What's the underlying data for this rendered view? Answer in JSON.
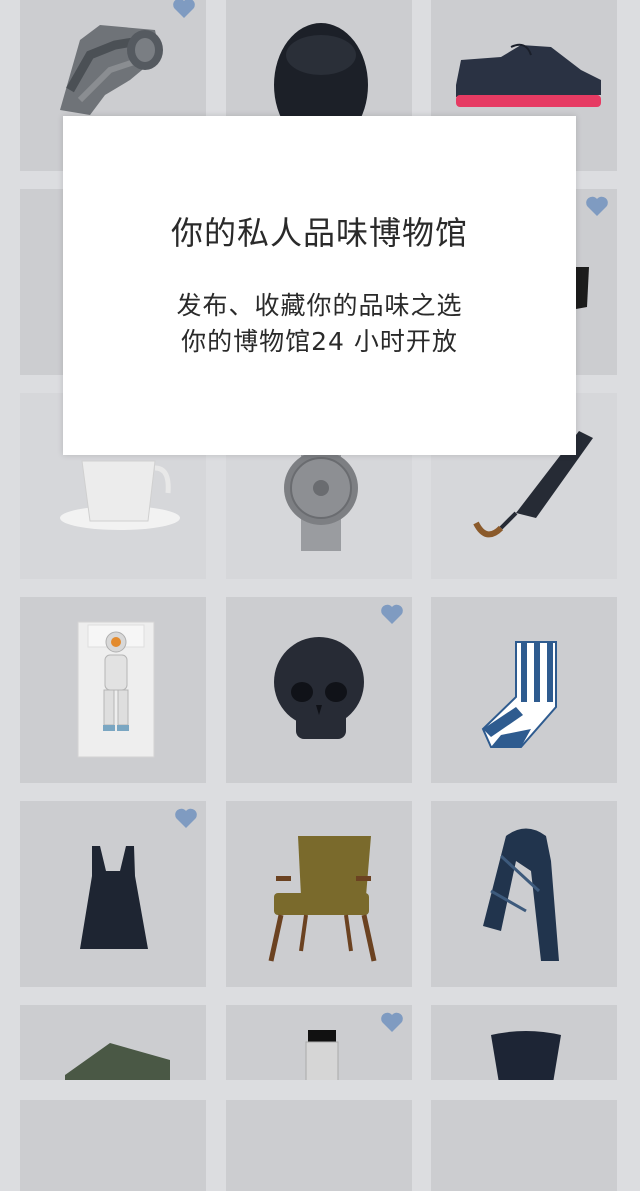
{
  "modal": {
    "title": "你的私人品味博物馆",
    "line1": "发布、收藏你的品味之选",
    "line2": "你的博物馆24 小时开放"
  },
  "colors": {
    "heart": "#7f9bc1",
    "background": "#dcdde0",
    "tile": "#cccdd0"
  },
  "items": [
    {
      "name": "camouflage-tie",
      "icon": "tie-icon",
      "favorited": true
    },
    {
      "name": "black-hat",
      "icon": "hat-icon",
      "favorited": false
    },
    {
      "name": "navy-shoe",
      "icon": "shoe-icon",
      "favorited": false
    },
    {
      "name": "item-row2-left",
      "icon": "item-icon",
      "favorited": false
    },
    {
      "name": "item-row2-mid",
      "icon": "item-icon",
      "favorited": false
    },
    {
      "name": "glasses",
      "icon": "glasses-icon",
      "favorited": true
    },
    {
      "name": "white-cup",
      "icon": "cup-icon",
      "favorited": false
    },
    {
      "name": "grey-watch",
      "icon": "watch-icon",
      "favorited": false
    },
    {
      "name": "umbrella",
      "icon": "umbrella-icon",
      "favorited": false
    },
    {
      "name": "astronaut-bedding",
      "icon": "bedding-icon",
      "favorited": false
    },
    {
      "name": "skull-candle",
      "icon": "skull-icon",
      "favorited": true
    },
    {
      "name": "striped-sock",
      "icon": "sock-icon",
      "favorited": false
    },
    {
      "name": "black-dress",
      "icon": "dress-icon",
      "favorited": true
    },
    {
      "name": "armchair",
      "icon": "chair-icon",
      "favorited": false
    },
    {
      "name": "patterned-scarf",
      "icon": "scarf-icon",
      "favorited": false
    },
    {
      "name": "green-case",
      "icon": "case-icon",
      "favorited": false
    },
    {
      "name": "paint-tube",
      "icon": "tube-icon",
      "favorited": true
    },
    {
      "name": "leather-pouch",
      "icon": "pouch-icon",
      "favorited": false
    }
  ]
}
